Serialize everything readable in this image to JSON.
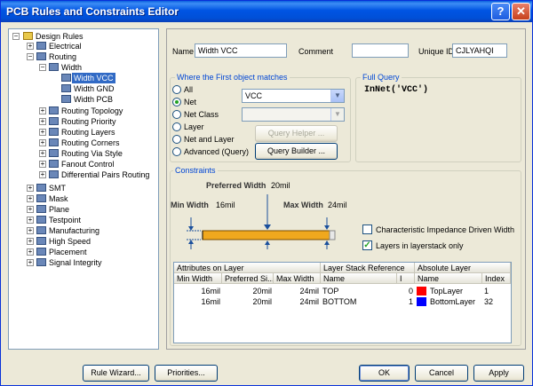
{
  "window": {
    "title": "PCB Rules and Constraints Editor"
  },
  "tree": {
    "root": "Design Rules",
    "items": [
      {
        "label": "Electrical"
      },
      {
        "label": "Routing"
      },
      {
        "label": "Width"
      },
      {
        "label": "Width VCC",
        "selected": true
      },
      {
        "label": "Width GND"
      },
      {
        "label": "Width PCB"
      },
      {
        "label": "Routing Topology"
      },
      {
        "label": "Routing Priority"
      },
      {
        "label": "Routing Layers"
      },
      {
        "label": "Routing Corners"
      },
      {
        "label": "Routing Via Style"
      },
      {
        "label": "Fanout Control"
      },
      {
        "label": "Differential Pairs Routing"
      },
      {
        "label": "SMT"
      },
      {
        "label": "Mask"
      },
      {
        "label": "Plane"
      },
      {
        "label": "Testpoint"
      },
      {
        "label": "Manufacturing"
      },
      {
        "label": "High Speed"
      },
      {
        "label": "Placement"
      },
      {
        "label": "Signal Integrity"
      }
    ]
  },
  "rule": {
    "name_label": "Name",
    "name_value": "Width VCC",
    "comment_label": "Comment",
    "comment_value": "",
    "uid_label": "Unique ID",
    "uid_value": "CJLYAHQI"
  },
  "match": {
    "group_title": "Where the First object matches",
    "options": [
      "All",
      "Net",
      "Net Class",
      "Layer",
      "Net and Layer",
      "Advanced (Query)"
    ],
    "net_value": "VCC",
    "netclass_value": "",
    "query_helper": "Query Helper ...",
    "query_builder": "Query Builder ..."
  },
  "fullquery": {
    "title": "Full Query",
    "text": "InNet('VCC')"
  },
  "constraints": {
    "title": "Constraints",
    "preferred_label": "Preferred Width",
    "preferred_value": "20mil",
    "min_label": "Min Width",
    "min_value": "16mil",
    "max_label": "Max Width",
    "max_value": "24mil",
    "impedance_label": "Characteristic Impedance Driven Width",
    "layers_only_label": "Layers in layerstack only"
  },
  "grid": {
    "group_headers": [
      "Attributes on Layer",
      "Layer Stack Reference",
      "Absolute Layer"
    ],
    "columns": [
      "Min Width",
      "Preferred Si...",
      "Max Width",
      "Name",
      "I",
      "Name",
      "Index"
    ],
    "rows": [
      {
        "min": "16mil",
        "pref": "20mil",
        "max": "24mil",
        "name": "TOP",
        "i": "0",
        "abs_name": "TopLayer",
        "index": "1"
      },
      {
        "min": "16mil",
        "pref": "20mil",
        "max": "24mil",
        "name": "BOTTOM",
        "i": "1",
        "abs_name": "BottomLayer",
        "index": "32"
      }
    ]
  },
  "colors": {
    "top_layer": "#ff0000",
    "bottom_layer": "#0000ff",
    "track": "#f0a81e"
  },
  "buttons": {
    "rule_wizard": "Rule Wizard...",
    "priorities": "Priorities...",
    "ok": "OK",
    "cancel": "Cancel",
    "apply": "Apply"
  }
}
